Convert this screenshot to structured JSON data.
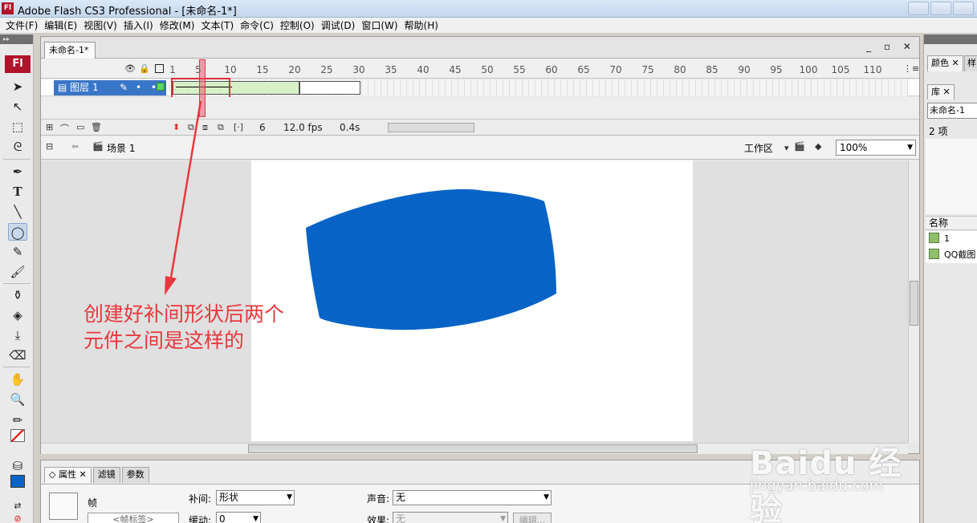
{
  "window": {
    "title": "Adobe Flash CS3 Professional - [未命名-1*]",
    "app_icon": "Fl"
  },
  "menu": [
    "文件(F)",
    "编辑(E)",
    "视图(V)",
    "插入(I)",
    "修改(M)",
    "文本(T)",
    "命令(C)",
    "控制(O)",
    "调试(D)",
    "窗口(W)",
    "帮助(H)"
  ],
  "toolbox": {
    "logo": "Fl"
  },
  "document": {
    "tab_label": "未命名-1*",
    "window_controls": "_ ▫ ✕"
  },
  "timeline": {
    "frame_numbers": [
      "1",
      "5",
      "10",
      "15",
      "20",
      "25",
      "30",
      "35",
      "40",
      "45",
      "50",
      "55",
      "60",
      "65",
      "70",
      "75",
      "80",
      "85",
      "90",
      "95",
      "100",
      "105",
      "110"
    ],
    "layer_name": "图层 1",
    "current_frame": "6",
    "frame_rate": "12.0 fps",
    "elapsed": "0.4s",
    "playhead_frame": 6,
    "tween_start_frame": 1,
    "tween_end_frame": 20,
    "last_frame": 30
  },
  "scene": {
    "name": "场景 1",
    "workspace": "工作区",
    "zoom": "100%"
  },
  "annotation": {
    "text_line1": "创建好补间形状后两个",
    "text_line2": "元件之间是这样的",
    "color": "#e8393f"
  },
  "shape": {
    "fill": "#0764c6"
  },
  "properties": {
    "tabs": [
      "属性",
      "滤镜",
      "参数"
    ],
    "frame_type": "帧",
    "frame_label_placeholder": "<帧标签>",
    "tween_label": "补间:",
    "tween_value": "形状",
    "ease_label": "缓动:",
    "ease_value": "0",
    "sound_label": "声音:",
    "sound_value": "无",
    "effect_label": "效果:",
    "effect_value": "无",
    "edit_button": "编辑..."
  },
  "right_panel": {
    "color_tab": "颜色",
    "sample_tab": "样",
    "library_tab": "库",
    "library_doc": "未命名-1",
    "item_count": "2 项",
    "name_header": "名称",
    "items": [
      "1",
      "QQ截图"
    ]
  },
  "watermark": {
    "brand": "Baidu 经验",
    "url": "jingyan.baidu.com"
  }
}
